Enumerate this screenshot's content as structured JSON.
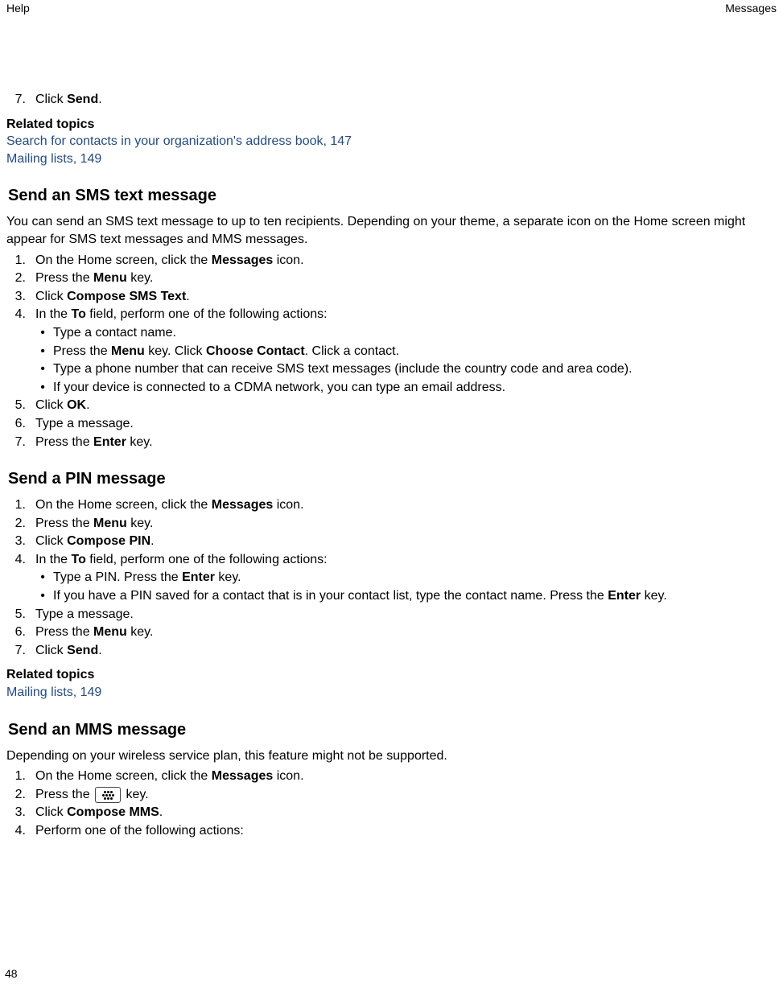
{
  "header": {
    "left": "Help",
    "right": "Messages"
  },
  "page_number": "48",
  "intro_step": {
    "num": "7.",
    "parts": [
      {
        "t": "Click ",
        "b": false
      },
      {
        "t": "Send",
        "b": true
      },
      {
        "t": ".",
        "b": false
      }
    ]
  },
  "related_topics_1": {
    "heading": "Related topics",
    "links": [
      "Search for contacts in your organization's address book, 147",
      "Mailing lists, 149"
    ]
  },
  "section_sms": {
    "heading": "Send an SMS text message",
    "intro": "You can send an SMS text message to up to ten recipients. Depending on your theme, a separate icon on the Home screen might appear for SMS text messages and MMS messages.",
    "steps": [
      {
        "num": "1.",
        "parts": [
          {
            "t": "On the Home screen, click the ",
            "b": false
          },
          {
            "t": "Messages",
            "b": true
          },
          {
            "t": " icon.",
            "b": false
          }
        ]
      },
      {
        "num": "2.",
        "parts": [
          {
            "t": "Press the ",
            "b": false
          },
          {
            "t": "Menu",
            "b": true
          },
          {
            "t": " key.",
            "b": false
          }
        ]
      },
      {
        "num": "3.",
        "parts": [
          {
            "t": "Click ",
            "b": false
          },
          {
            "t": "Compose SMS Text",
            "b": true
          },
          {
            "t": ".",
            "b": false
          }
        ]
      },
      {
        "num": "4.",
        "parts": [
          {
            "t": "In the ",
            "b": false
          },
          {
            "t": "To",
            "b": true
          },
          {
            "t": " field, perform one of the following actions:",
            "b": false
          }
        ]
      }
    ],
    "sub_bullets": [
      {
        "parts": [
          {
            "t": "Type a contact name.",
            "b": false
          }
        ]
      },
      {
        "parts": [
          {
            "t": "Press the ",
            "b": false
          },
          {
            "t": "Menu",
            "b": true
          },
          {
            "t": " key. Click ",
            "b": false
          },
          {
            "t": "Choose Contact",
            "b": true
          },
          {
            "t": ". Click a contact.",
            "b": false
          }
        ]
      },
      {
        "parts": [
          {
            "t": "Type a phone number that can receive SMS text messages (include the country code and area code).",
            "b": false
          }
        ]
      },
      {
        "parts": [
          {
            "t": "If your device is connected to a CDMA network, you can type an email address.",
            "b": false
          }
        ]
      }
    ],
    "steps_after": [
      {
        "num": "5.",
        "parts": [
          {
            "t": "Click ",
            "b": false
          },
          {
            "t": "OK",
            "b": true
          },
          {
            "t": ".",
            "b": false
          }
        ]
      },
      {
        "num": "6.",
        "parts": [
          {
            "t": "Type a message.",
            "b": false
          }
        ]
      },
      {
        "num": "7.",
        "parts": [
          {
            "t": "Press the ",
            "b": false
          },
          {
            "t": "Enter",
            "b": true
          },
          {
            "t": " key.",
            "b": false
          }
        ]
      }
    ]
  },
  "section_pin": {
    "heading": "Send a PIN message",
    "steps": [
      {
        "num": "1.",
        "parts": [
          {
            "t": "On the Home screen, click the ",
            "b": false
          },
          {
            "t": "Messages",
            "b": true
          },
          {
            "t": " icon.",
            "b": false
          }
        ]
      },
      {
        "num": "2.",
        "parts": [
          {
            "t": "Press the ",
            "b": false
          },
          {
            "t": "Menu",
            "b": true
          },
          {
            "t": " key.",
            "b": false
          }
        ]
      },
      {
        "num": "3.",
        "parts": [
          {
            "t": "Click ",
            "b": false
          },
          {
            "t": "Compose PIN",
            "b": true
          },
          {
            "t": ".",
            "b": false
          }
        ]
      },
      {
        "num": "4.",
        "parts": [
          {
            "t": "In the ",
            "b": false
          },
          {
            "t": "To",
            "b": true
          },
          {
            "t": " field, perform one of the following actions:",
            "b": false
          }
        ]
      }
    ],
    "sub_bullets": [
      {
        "parts": [
          {
            "t": "Type a PIN. Press the ",
            "b": false
          },
          {
            "t": "Enter",
            "b": true
          },
          {
            "t": " key.",
            "b": false
          }
        ]
      },
      {
        "parts": [
          {
            "t": "If you have a PIN saved for a contact that is in your contact list, type the contact name. Press the ",
            "b": false
          },
          {
            "t": "Enter",
            "b": true
          },
          {
            "t": " key.",
            "b": false
          }
        ]
      }
    ],
    "steps_after": [
      {
        "num": "5.",
        "parts": [
          {
            "t": "Type a message.",
            "b": false
          }
        ]
      },
      {
        "num": "6.",
        "parts": [
          {
            "t": "Press the ",
            "b": false
          },
          {
            "t": "Menu",
            "b": true
          },
          {
            "t": " key.",
            "b": false
          }
        ]
      },
      {
        "num": "7.",
        "parts": [
          {
            "t": "Click ",
            "b": false
          },
          {
            "t": "Send",
            "b": true
          },
          {
            "t": ".",
            "b": false
          }
        ]
      }
    ]
  },
  "related_topics_2": {
    "heading": "Related topics",
    "links": [
      "Mailing lists, 149"
    ]
  },
  "section_mms": {
    "heading": "Send an MMS message",
    "intro": "Depending on your wireless service plan, this feature might not be supported.",
    "step1": {
      "num": "1.",
      "parts": [
        {
          "t": "On the Home screen, click the ",
          "b": false
        },
        {
          "t": "Messages",
          "b": true
        },
        {
          "t": " icon.",
          "b": false
        }
      ]
    },
    "step2": {
      "num": "2.",
      "pre": "Press the ",
      "post": " key."
    },
    "steps_after": [
      {
        "num": "3.",
        "parts": [
          {
            "t": "Click ",
            "b": false
          },
          {
            "t": "Compose MMS",
            "b": true
          },
          {
            "t": ".",
            "b": false
          }
        ]
      },
      {
        "num": "4.",
        "parts": [
          {
            "t": "Perform one of the following actions:",
            "b": false
          }
        ]
      }
    ]
  }
}
